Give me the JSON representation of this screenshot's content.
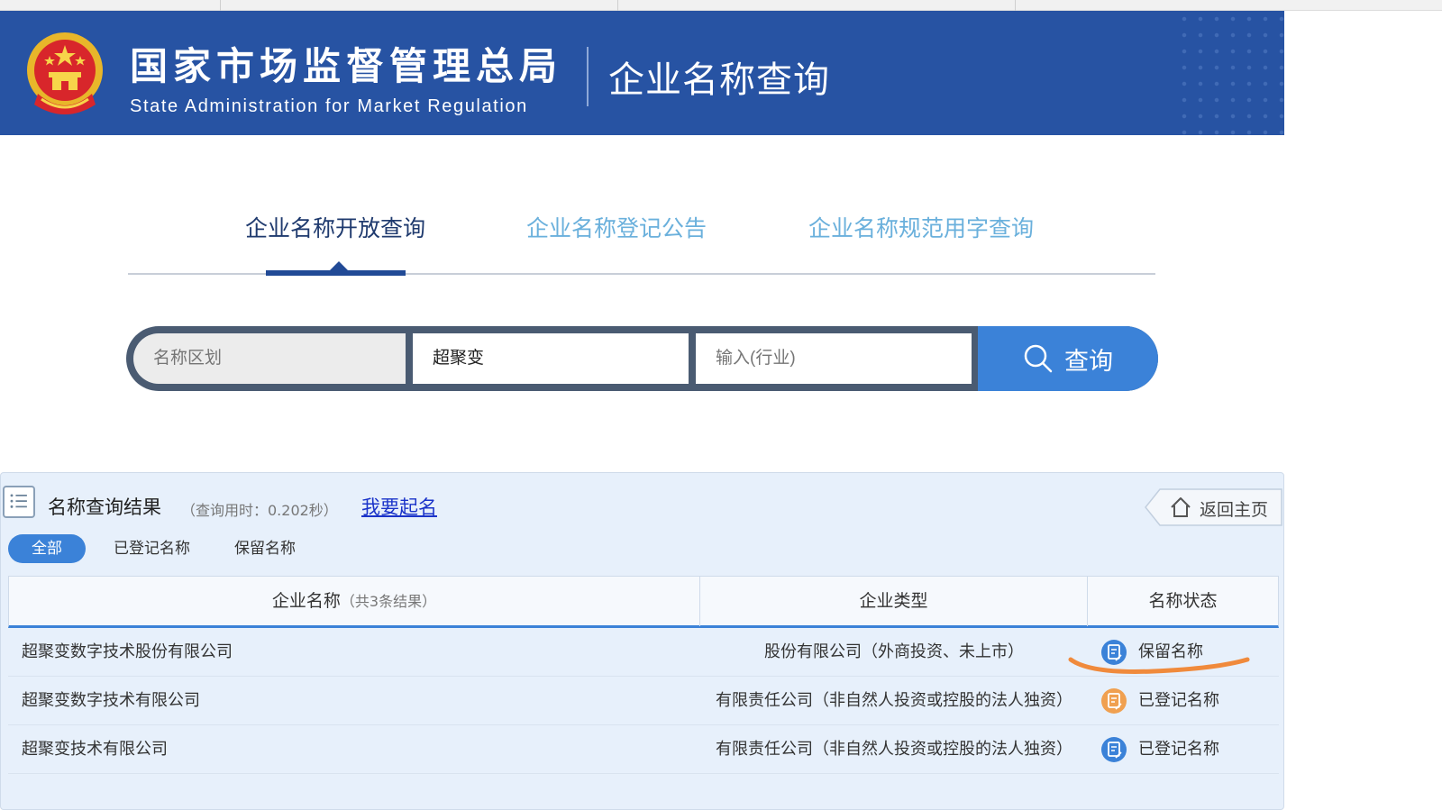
{
  "header": {
    "org_name_cn": "国家市场监督管理总局",
    "org_name_en": "State Administration for Market Regulation",
    "site_title": "企业名称查询"
  },
  "main_tabs": [
    {
      "label": "企业名称开放查询",
      "active": true
    },
    {
      "label": "企业名称登记公告",
      "active": false
    },
    {
      "label": "企业名称规范用字查询",
      "active": false
    }
  ],
  "search": {
    "region_placeholder": "名称区划",
    "name_value": "超聚变",
    "industry_placeholder": "输入(行业)",
    "button_label": "查询"
  },
  "results": {
    "title": "名称查询结果",
    "elapsed": "（查询用时：0.202秒）",
    "naming_link": "我要起名",
    "home_button": "返回主页",
    "filters": [
      "全部",
      "已登记名称",
      "保留名称"
    ],
    "active_filter": "全部",
    "columns": {
      "name": "企业名称",
      "name_count": "（共3条结果）",
      "type": "企业类型",
      "status": "名称状态"
    },
    "rows": [
      {
        "name": "超聚变数字技术股份有限公司",
        "type": "股份有限公司（外商投资、未上市）",
        "status": "保留名称",
        "status_color": "#3b82d8"
      },
      {
        "name": "超聚变数字技术有限公司",
        "type": "有限责任公司（非自然人投资或控股的法人独资）",
        "status": "已登记名称",
        "status_color": "#f0a050"
      },
      {
        "name": "超聚变技术有限公司",
        "type": "有限责任公司（非自然人投资或控股的法人独资）",
        "status": "已登记名称",
        "status_color": "#3b82d8"
      }
    ]
  },
  "colors": {
    "banner": "#2753a3",
    "accent": "#3b82d8",
    "annotation": "#f08a3c"
  }
}
